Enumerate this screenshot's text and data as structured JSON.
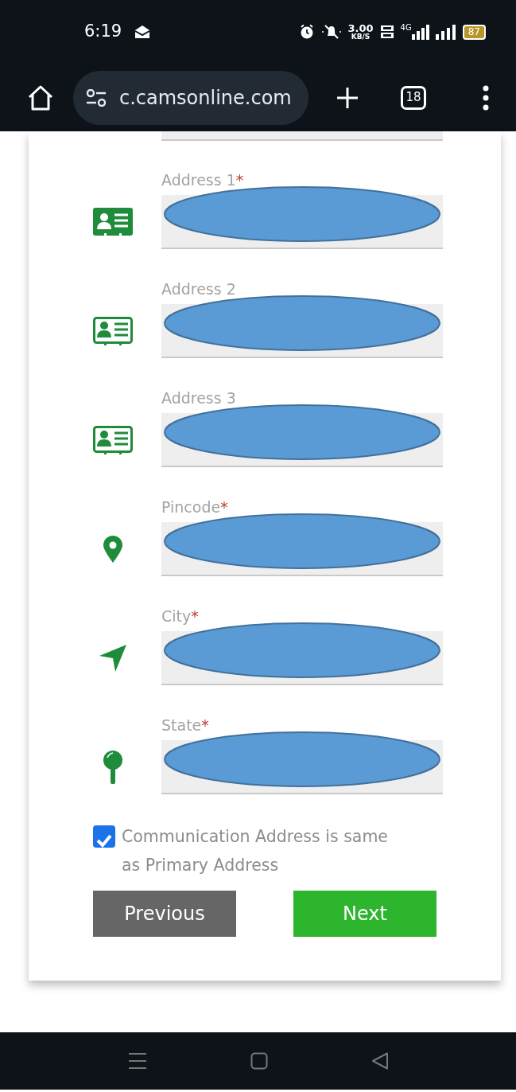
{
  "status_bar": {
    "time": "6:19",
    "speed_value": "3.00",
    "speed_unit": "KB/S",
    "network_type": "4G",
    "battery": "87"
  },
  "browser": {
    "url": "c.camsonline.com",
    "tab_count": "18"
  },
  "form": {
    "fields": [
      {
        "kind": "blank"
      },
      {
        "kind": "id-card-filled",
        "label": "Address 1",
        "required_mark": "*",
        "redacted": true
      },
      {
        "kind": "id-card",
        "label": "Address 2",
        "redacted": true
      },
      {
        "kind": "id-card",
        "label": "Address 3",
        "redacted": true
      },
      {
        "kind": "pin",
        "label": "Pincode",
        "required_mark": "*",
        "redacted": true
      },
      {
        "kind": "navigation",
        "label": "City",
        "required_mark": "*",
        "redacted": true
      },
      {
        "kind": "pushpin",
        "label": "State",
        "required_mark": "*",
        "redacted": true
      }
    ],
    "same_address": {
      "checked": true,
      "label": "Communication Address is same as Primary Address"
    },
    "buttons": [
      {
        "kind": "previous",
        "label": "Previous"
      },
      {
        "kind": "next",
        "label": "Next"
      }
    ]
  }
}
